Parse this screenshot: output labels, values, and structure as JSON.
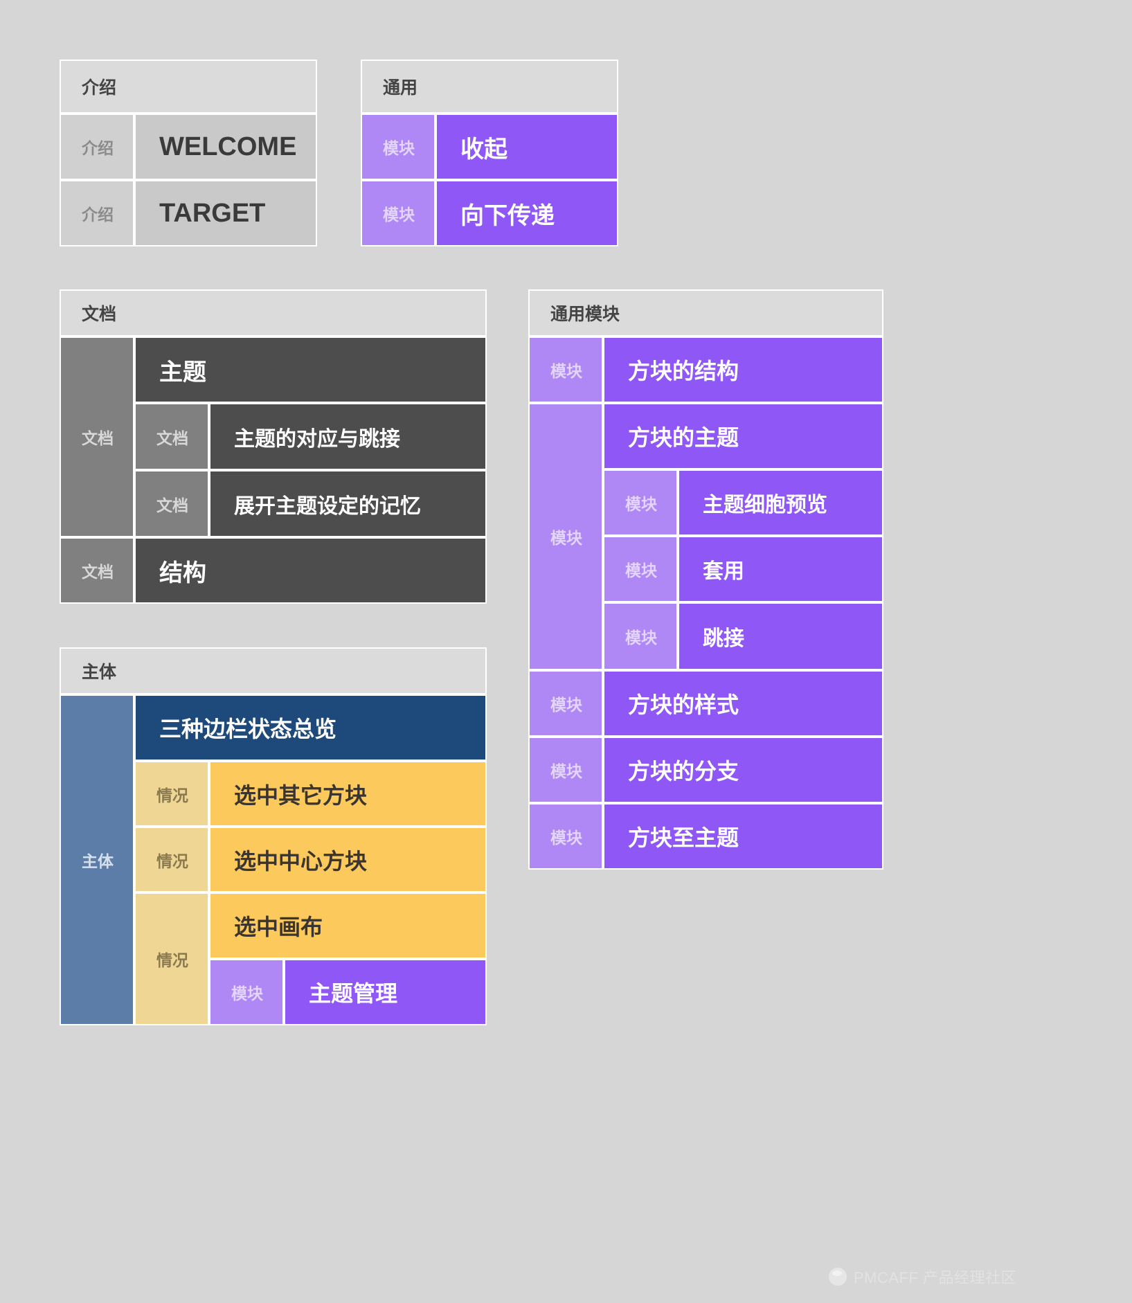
{
  "watermark": {
    "text": "PMCAFF 产品经理社区"
  },
  "labels": {
    "intro": "介绍",
    "doc": "文档",
    "module": "模块",
    "body": "主体",
    "case": "情况"
  },
  "panels": {
    "intro": {
      "header": "介绍",
      "rows": [
        {
          "tag": "介绍",
          "title": "WELCOME"
        },
        {
          "tag": "介绍",
          "title": "TARGET"
        }
      ]
    },
    "common": {
      "header": "通用",
      "rows": [
        {
          "tag": "模块",
          "title": "收起"
        },
        {
          "tag": "模块",
          "title": "向下传递"
        }
      ]
    },
    "document": {
      "header": "文档",
      "spine": "文档",
      "topic": "主题",
      "sub": [
        {
          "tag": "文档",
          "title": "主题的对应与跳接"
        },
        {
          "tag": "文档",
          "title": "展开主题设定的记忆"
        }
      ],
      "structure": {
        "tag": "文档",
        "title": "结构"
      }
    },
    "common_module": {
      "header": "通用模块",
      "rows": [
        {
          "tag": "模块",
          "title": "方块的结构"
        }
      ],
      "group": {
        "spine": "模块",
        "head": "方块的主题",
        "children": [
          {
            "tag": "模块",
            "title": "主题细胞预览"
          },
          {
            "tag": "模块",
            "title": "套用"
          },
          {
            "tag": "模块",
            "title": "跳接"
          }
        ]
      },
      "tail": [
        {
          "tag": "模块",
          "title": "方块的样式"
        },
        {
          "tag": "模块",
          "title": "方块的分支"
        },
        {
          "tag": "模块",
          "title": "方块至主题"
        }
      ]
    },
    "body": {
      "header": "主体",
      "spine": "主体",
      "overview": "三种边栏状态总览",
      "cases": [
        {
          "tag": "情况",
          "title": "选中其它方块"
        },
        {
          "tag": "情况",
          "title": "选中中心方块"
        }
      ],
      "canvas_case": {
        "tag": "情况",
        "title": "选中画布",
        "child": {
          "tag": "模块",
          "title": "主题管理"
        }
      }
    }
  },
  "colors": {
    "background": "#d6d6d6",
    "gray_tag": "#d0d0d0",
    "gray_title": "#c9c9c9",
    "doc_tag": "#808080",
    "doc_title": "#4d4d4d",
    "purple_tag": "#b088f5",
    "purple_title": "#9057f7",
    "blue_tag": "#5b7da8",
    "blue_title": "#1d4a7a",
    "yellow_tag": "#f0d694",
    "yellow_title": "#fcca5c"
  }
}
